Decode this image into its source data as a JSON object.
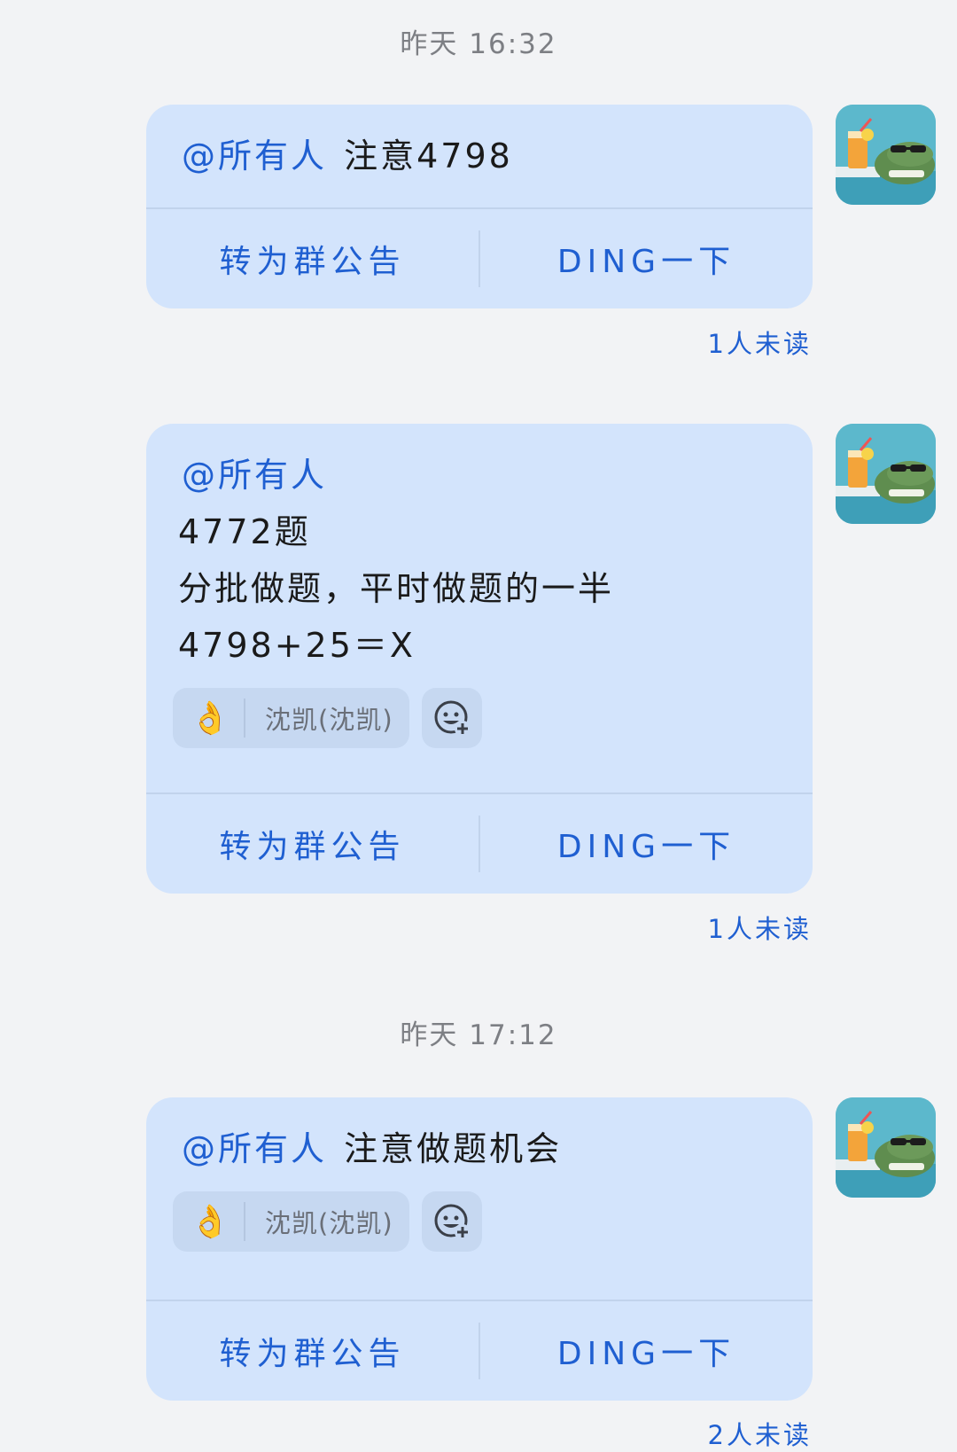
{
  "timestamps": [
    "昨天 16:32",
    "昨天 17:12"
  ],
  "messages": [
    {
      "mention": "@所有人",
      "lines": [
        "注意4798"
      ],
      "reaction": null,
      "actions": {
        "announce": "转为群公告",
        "ding": "DING一下"
      },
      "unread": "1人未读"
    },
    {
      "mention": "@所有人",
      "lines": [
        "4772题",
        "分批做题，平时做题的一半",
        "4798+25＝X"
      ],
      "reaction": {
        "emoji": "👌",
        "user": "沈凯(沈凯)"
      },
      "actions": {
        "announce": "转为群公告",
        "ding": "DING一下"
      },
      "unread": "1人未读"
    },
    {
      "mention": "@所有人",
      "lines": [
        "注意做题机会"
      ],
      "reaction": {
        "emoji": "👌",
        "user": "沈凯(沈凯)"
      },
      "actions": {
        "announce": "转为群公告",
        "ding": "DING一下"
      },
      "unread": "2人未读"
    }
  ],
  "icons": {
    "avatar": "crocodile-sunglasses-avatar",
    "add_reaction": "emoji-add-icon"
  },
  "colors": {
    "bubble": "#d3e4fc",
    "accent": "#1f5fd1",
    "background": "#f2f3f5"
  }
}
